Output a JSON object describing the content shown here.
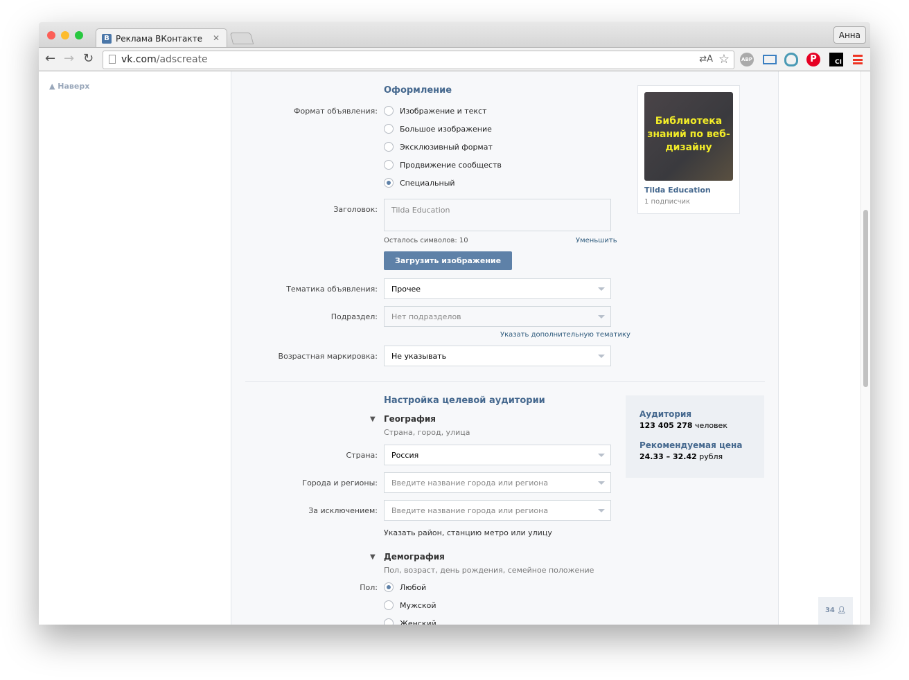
{
  "browser": {
    "tab_title": "Реклама ВКонтакте",
    "favicon_letter": "В",
    "url_host": "vk.com",
    "url_path": "/adscreate",
    "profile": "Анна",
    "translate": "⇄A",
    "extensions": [
      "adblock-icon",
      "screen-capture-icon",
      "ext-drop-icon",
      "pinterest-icon",
      "ci-icon",
      "menu-icon"
    ],
    "ci_label": "CI",
    "abp_label": "ABP"
  },
  "sidebar": {
    "top_link": "Наверх"
  },
  "design": {
    "title": "Оформление",
    "format_label": "Формат объявления:",
    "formats": [
      {
        "label": "Изображение и текст",
        "checked": false
      },
      {
        "label": "Большое изображение",
        "checked": false
      },
      {
        "label": "Эксклюзивный формат",
        "checked": false
      },
      {
        "label": "Продвижение сообществ",
        "checked": false
      },
      {
        "label": "Специальный",
        "checked": true
      }
    ],
    "headline_label": "Заголовок:",
    "headline_value": "Tilda Education",
    "chars_left": "Осталось символов: 10",
    "reduce": "Уменьшить",
    "upload_button": "Загрузить изображение",
    "topic_label": "Тематика объявления:",
    "topic_value": "Прочее",
    "subsection_label": "Подраздел:",
    "subsection_value": "Нет подразделов",
    "extra_topic": "Указать дополнительную тематику",
    "age_label": "Возрастная маркировка:",
    "age_value": "Не указывать"
  },
  "preview": {
    "image_text": "Библиотека знаний по веб-дизайну",
    "name": "Tilda Education",
    "subscribers": "1 подписчик"
  },
  "audience": {
    "title": "Настройка целевой аудитории",
    "geo_title": "География",
    "geo_sub": "Страна, город, улица",
    "country_label": "Страна:",
    "country_value": "Россия",
    "cities_label": "Города и регионы:",
    "cities_placeholder": "Введите название города или региона",
    "except_label": "За исключением:",
    "except_placeholder": "Введите название города или региона",
    "district_link": "Указать район, станцию метро или улицу",
    "demo_title": "Демография",
    "demo_sub": "Пол, возраст, день рождения, семейное положение",
    "sex_label": "Пол:",
    "sexes": [
      {
        "label": "Любой",
        "checked": true
      },
      {
        "label": "Мужской",
        "checked": false
      },
      {
        "label": "Женский",
        "checked": false
      }
    ]
  },
  "stats": {
    "audience_title": "Аудитория",
    "audience_count": "123 405 278",
    "audience_unit": "человек",
    "price_title": "Рекомендуемая цена",
    "price_range": "24.33 – 32.42",
    "price_unit": "рубля"
  },
  "online": {
    "count": "34"
  },
  "colors": {
    "accent": "#5e81a8",
    "heading": "#45688e",
    "panel": "#edf0f4"
  }
}
